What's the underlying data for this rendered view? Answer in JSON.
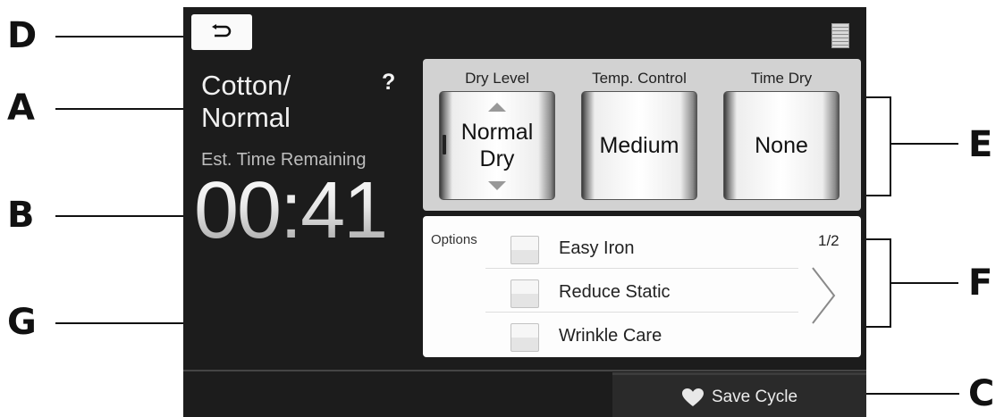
{
  "callouts": {
    "d": "D",
    "a": "A",
    "b": "B",
    "g": "G",
    "e": "E",
    "f": "F",
    "c": "C"
  },
  "screen": {
    "back_icon": "back-arrow-icon",
    "menu_icon": "menu-list-icon",
    "cycle": {
      "line1": "Cotton/",
      "line2": "Normal"
    },
    "help": "?",
    "est_label": "Est. Time Remaining",
    "time": "00:41",
    "settings": [
      {
        "label": "Dry Level",
        "value_line1": "Normal",
        "value_line2": "Dry"
      },
      {
        "label": "Temp. Control",
        "value": "Medium"
      },
      {
        "label": "Time Dry",
        "value": "None"
      }
    ],
    "options": {
      "title": "Options",
      "page": "1/2",
      "items": [
        "Easy Iron",
        "Reduce Static",
        "Wrinkle Care"
      ]
    },
    "save_label": "Save Cycle",
    "save_icon": "heart-icon"
  },
  "colors": {
    "screen_bg": "#1c1c1c",
    "panel_bg": "#d2d2d2",
    "options_bg": "#fdfdfd"
  }
}
